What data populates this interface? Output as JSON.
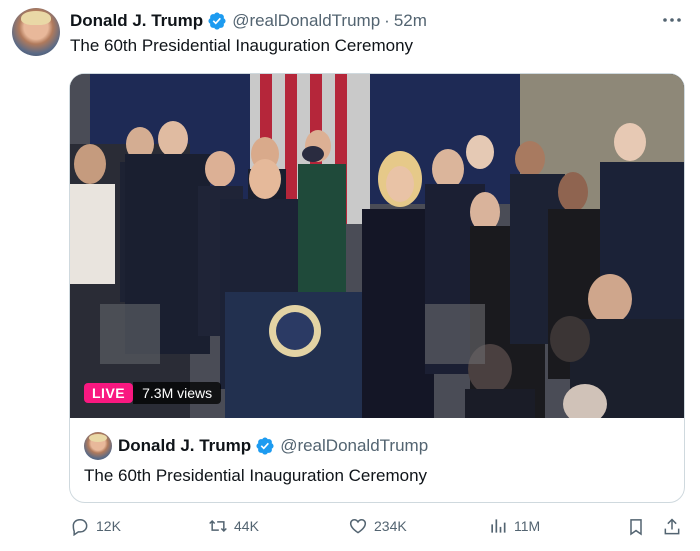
{
  "post": {
    "author_name": "Donald J. Trump",
    "handle": "@realDonaldTrump",
    "separator": "·",
    "time": "52m",
    "text": "The 60th Presidential Inauguration Ceremony",
    "media": {
      "live_label": "LIVE",
      "views": "7.3M views"
    }
  },
  "quote": {
    "author_name": "Donald J. Trump",
    "handle": "@realDonaldTrump",
    "text": "The 60th Presidential Inauguration Ceremony"
  },
  "actions": {
    "replies": "12K",
    "reposts": "44K",
    "likes": "234K",
    "views": "11M"
  },
  "colors": {
    "verified": "#1d9bf0",
    "live": "#f91880",
    "muted": "#536471",
    "border": "#cfd9de"
  }
}
